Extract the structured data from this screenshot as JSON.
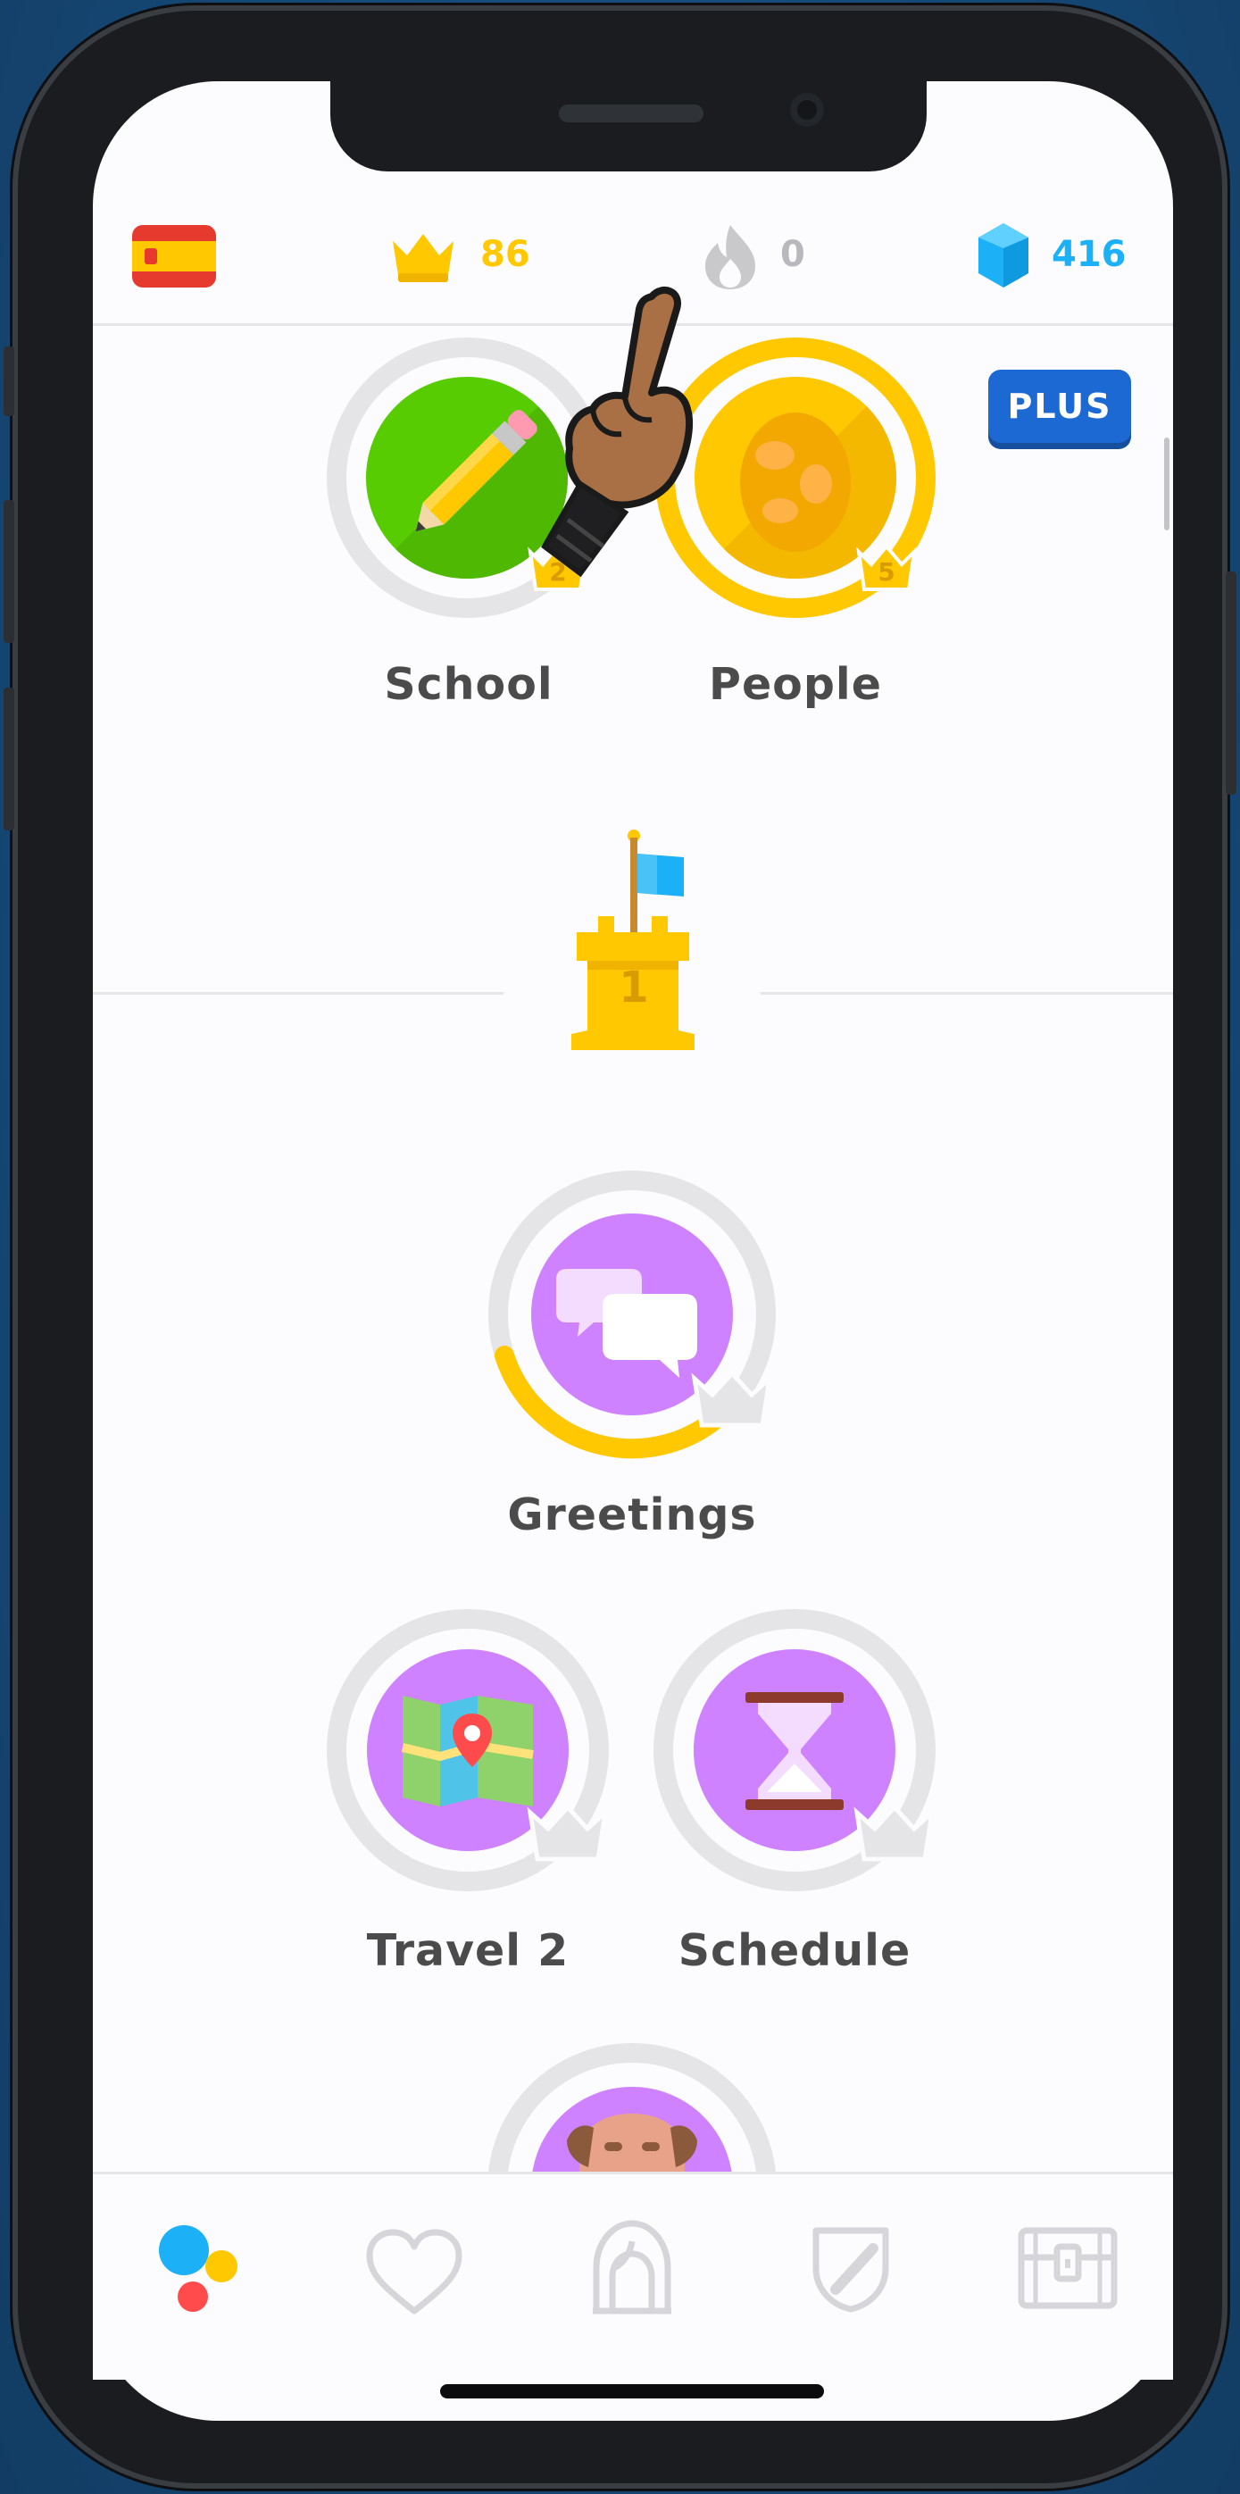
{
  "header": {
    "crowns": "86",
    "streak": "0",
    "gems": "416",
    "plus_label": "PLUS"
  },
  "skills": {
    "school": {
      "label": "School",
      "crown_level": "2"
    },
    "people": {
      "label": "People",
      "crown_level": "5"
    },
    "greetings": {
      "label": "Greetings"
    },
    "travel2": {
      "label": "Travel 2"
    },
    "schedule": {
      "label": "Schedule"
    }
  },
  "checkpoint": {
    "number": "1"
  },
  "colors": {
    "gold": "#ffc800",
    "green": "#58cc02",
    "purple": "#ce82ff",
    "blue": "#1cb0f6",
    "plus_blue": "#1c69d3",
    "text": "#4b4b4b"
  },
  "icons": {
    "flag": "spain-flag-icon",
    "crown": "crown-icon",
    "streak": "flame-icon",
    "gems": "gem-icon",
    "nav": [
      "learn-icon",
      "heart-icon",
      "profile-icon",
      "shield-icon",
      "treasure-chest-icon"
    ]
  }
}
